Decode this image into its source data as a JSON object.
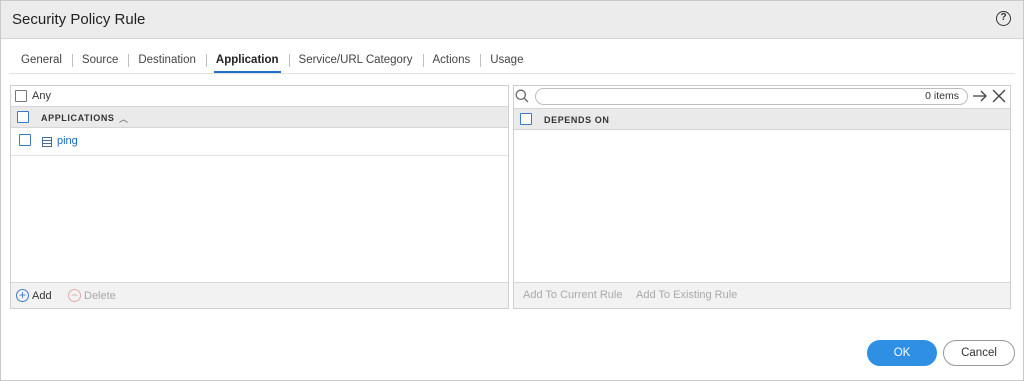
{
  "dialog": {
    "title": "Security Policy Rule",
    "help_glyph": "?"
  },
  "tabs": [
    {
      "label": "General",
      "active": false
    },
    {
      "label": "Source",
      "active": false
    },
    {
      "label": "Destination",
      "active": false
    },
    {
      "label": "Application",
      "active": true
    },
    {
      "label": "Service/URL Category",
      "active": false
    },
    {
      "label": "Actions",
      "active": false
    },
    {
      "label": "Usage",
      "active": false
    }
  ],
  "applications_panel": {
    "any_label": "Any",
    "any_checked": false,
    "column_header": "APPLICATIONS",
    "sort_icon": "chevron-up-icon",
    "sort_glyph": "︿",
    "rows": [
      {
        "icon": "application-list-icon",
        "name": "ping",
        "checked": false
      }
    ],
    "add_label": "Add",
    "add_glyph": "+",
    "delete_label": "Delete",
    "delete_glyph": "−"
  },
  "depends_panel": {
    "search": {
      "value": "",
      "items_count": "0 items"
    },
    "column_header": "DEPENDS ON",
    "add_to_current": "Add To Current Rule",
    "add_to_existing": "Add To Existing Rule"
  },
  "buttons": {
    "ok": "OK",
    "cancel": "Cancel"
  },
  "colors": {
    "accent": "#2f8fe3",
    "link": "#1b6bc2",
    "tab_underline": "#1b72c6"
  }
}
